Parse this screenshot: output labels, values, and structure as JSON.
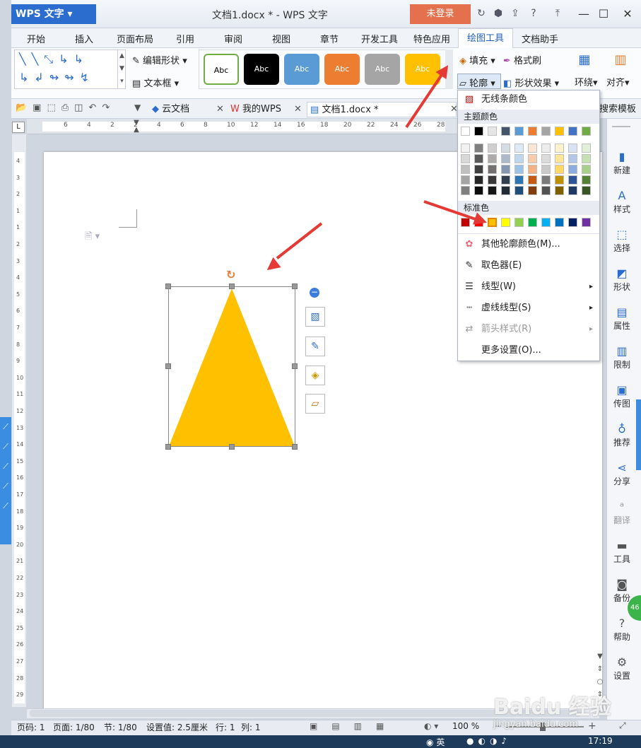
{
  "app": {
    "logo": "WPS 文字",
    "title": "文档1.docx * - WPS 文字",
    "login": "未登录"
  },
  "menu": [
    "开始",
    "插入",
    "页面布局",
    "引用",
    "审阅",
    "视图",
    "章节",
    "开发工具",
    "特色应用",
    "绘图工具",
    "文档助手"
  ],
  "menu_active": "绘图工具",
  "ribbon": {
    "edit_shape": "编辑形状",
    "textbox": "文本框",
    "style_label": "Abc",
    "fill": "填充",
    "format_painter": "格式刷",
    "outline": "轮廓",
    "shape_effect": "形状效果",
    "wrap": "环绕",
    "align": "对齐",
    "search_template": "搜索模板"
  },
  "style_colors": [
    "#ffffff",
    "#000000",
    "#5b9bd5",
    "#ed7d31",
    "#a5a5a5",
    "#ffc000"
  ],
  "tabs": {
    "cloud": "云文档",
    "mywps": "我的WPS",
    "doc": "文档1.docx *"
  },
  "ruler_numbers": [
    "6",
    "4",
    "2",
    "2",
    "4",
    "6",
    "8",
    "10",
    "12",
    "14",
    "16",
    "18",
    "20",
    "22",
    "24",
    "26",
    "28"
  ],
  "vruler_numbers": [
    "4",
    "3",
    "2",
    "1",
    "1",
    "2",
    "3",
    "4",
    "5",
    "6",
    "7",
    "8",
    "9",
    "10",
    "11",
    "12",
    "13",
    "14",
    "15",
    "16",
    "17",
    "18",
    "19",
    "20",
    "21",
    "22",
    "23",
    "24",
    "25",
    "26",
    "27",
    "28",
    "29"
  ],
  "shape_color": "#ffc000",
  "dropdown": {
    "no_line": "无线条颜色",
    "theme_colors": "主题颜色",
    "standard_colors": "标准色",
    "more_colors": "其他轮廓颜色(M)...",
    "eyedropper": "取色器(E)",
    "line_type": "线型(W)",
    "dash_type": "虚线线型(S)",
    "arrow_style": "箭头样式(R)",
    "more_settings": "更多设置(O)..."
  },
  "theme_top": [
    "#ffffff",
    "#000000",
    "#e7e6e6",
    "#44546a",
    "#5b9bd5",
    "#ed7d31",
    "#a5a5a5",
    "#ffc000",
    "#4472c4",
    "#70ad47"
  ],
  "theme_shades": [
    [
      "#f2f2f2",
      "#7f7f7f",
      "#d0cece",
      "#d6dce4",
      "#deebf6",
      "#fbe5d5",
      "#ededed",
      "#fff2cc",
      "#dae3f3",
      "#e2efd9"
    ],
    [
      "#d8d8d8",
      "#595959",
      "#aeaaaa",
      "#adb9ca",
      "#bdd7ee",
      "#f7cbac",
      "#dbdbdb",
      "#fee599",
      "#b4c6e7",
      "#c5e0b3"
    ],
    [
      "#bfbfbf",
      "#3f3f3f",
      "#757070",
      "#8496b0",
      "#9cc3e5",
      "#f4b183",
      "#c9c9c9",
      "#ffd965",
      "#8faadc",
      "#a8d08d"
    ],
    [
      "#a5a5a5",
      "#262626",
      "#3a3838",
      "#323f4f",
      "#2e75b5",
      "#c55a11",
      "#7b7b7b",
      "#bf9000",
      "#2f5496",
      "#538135"
    ],
    [
      "#7f7f7f",
      "#0c0c0c",
      "#171616",
      "#222a35",
      "#1e4e79",
      "#833c0b",
      "#525252",
      "#7f6000",
      "#1f3864",
      "#375623"
    ]
  ],
  "standard": [
    "#c00000",
    "#ff0000",
    "#ffc000",
    "#ffff00",
    "#92d050",
    "#00b050",
    "#00b0f0",
    "#0070c0",
    "#002060",
    "#7030a0"
  ],
  "side": [
    "新建",
    "样式",
    "选择",
    "形状",
    "属性",
    "限制",
    "传图",
    "推荐",
    "分享",
    "翻译",
    "工具",
    "备份",
    "帮助",
    "设置"
  ],
  "status": {
    "page": "页码: 1",
    "pages": "页面: 1/80",
    "section": "节: 1/80",
    "setting": "设置值: 2.5厘米",
    "row": "行: 1",
    "col": "列: 1",
    "zoom": "100 %"
  },
  "taskbar": {
    "time": "17:19",
    "ime": "英"
  },
  "watermark": "Baidu 经验",
  "watermark_url": "jingyan.baidu.com",
  "badge": "46"
}
